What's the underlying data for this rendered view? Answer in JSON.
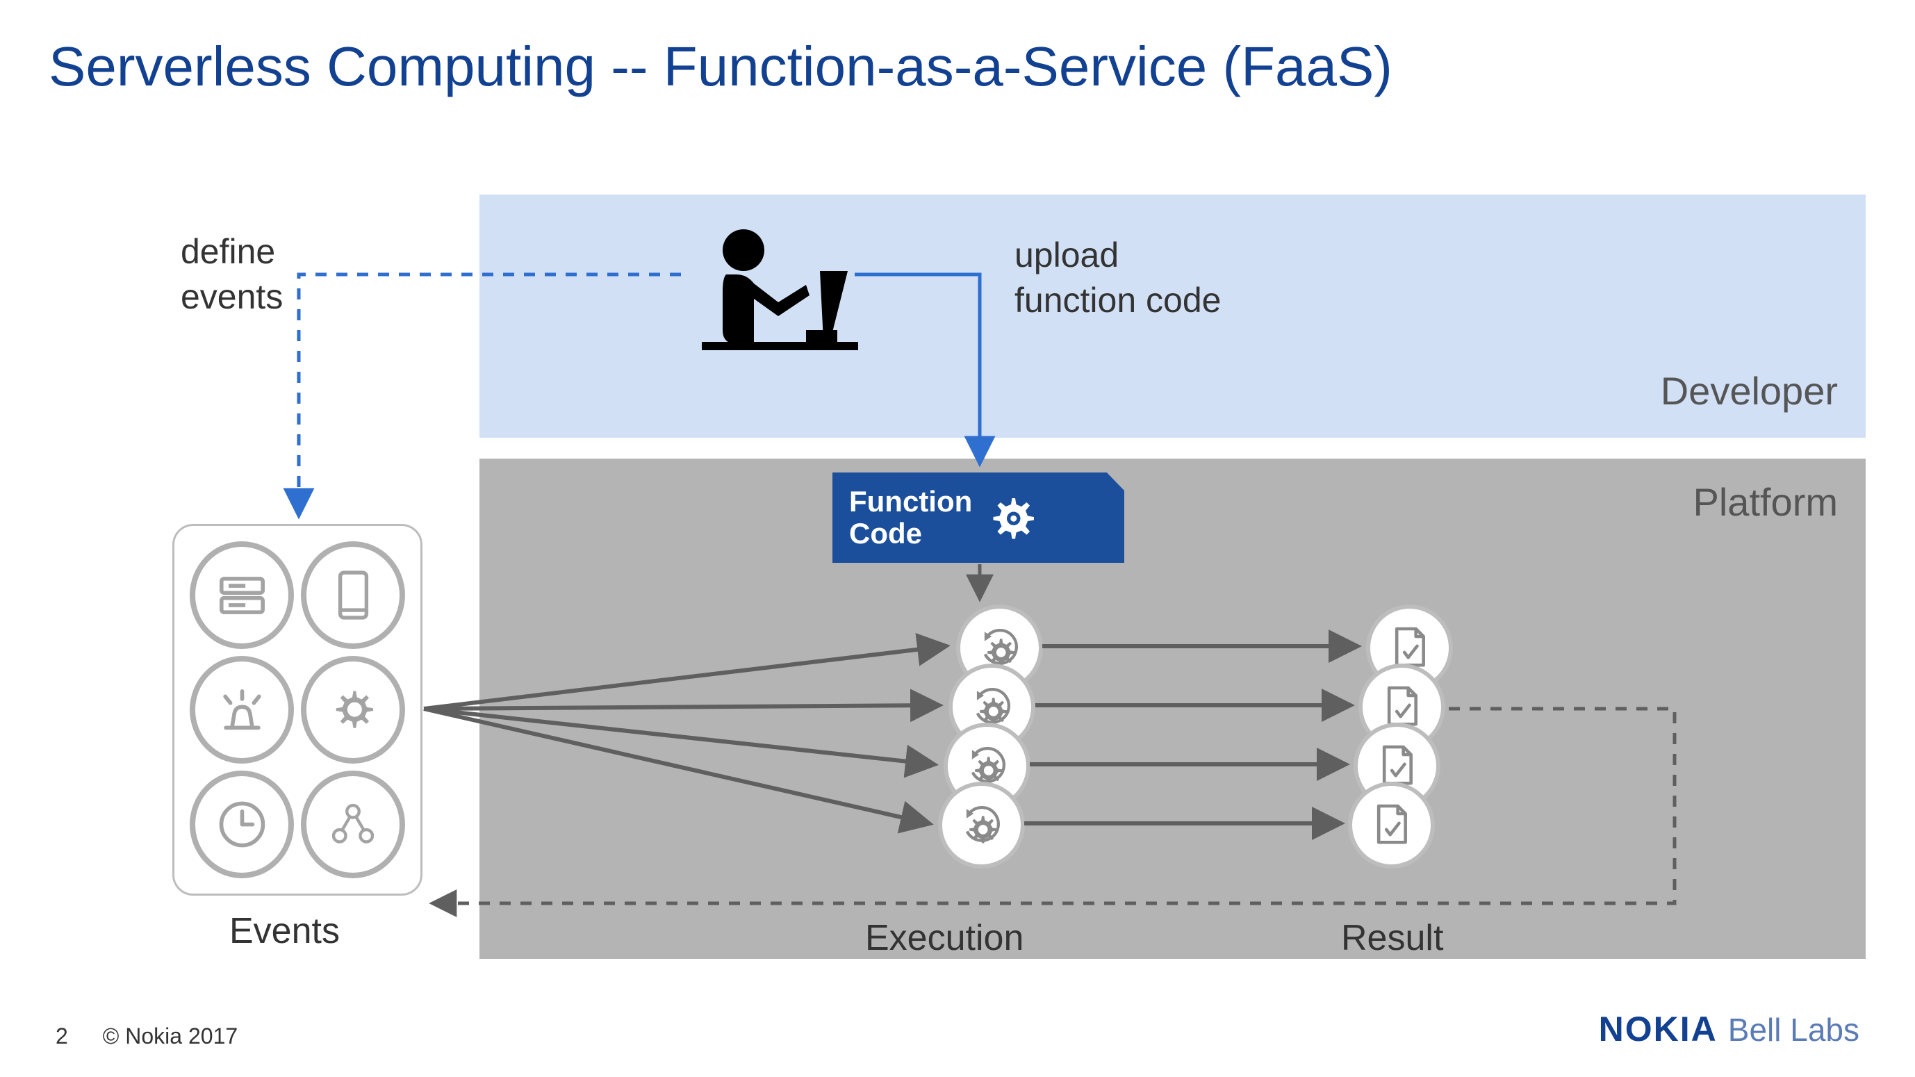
{
  "title": "Serverless Computing -- Function-as-a-Service (FaaS)",
  "labels": {
    "define_events_1": "define",
    "define_events_2": "events",
    "upload_1": "upload",
    "upload_2": "function code",
    "developer": "Developer",
    "platform": "Platform",
    "function_code_1": "Function",
    "function_code_2": "Code",
    "events": "Events",
    "execution": "Execution",
    "result": "Result"
  },
  "footer": {
    "page": "2",
    "copyright": "© Nokia 2017"
  },
  "logo": {
    "brand": "NOKIA",
    "sub": "Bell Labs"
  },
  "colors": {
    "title": "#124191",
    "developer_bg": "#d2e0f6",
    "platform_bg": "#b4b4b4",
    "function_code_bg": "#1b4f9c",
    "icon_gray": "#a3a3a3",
    "arrow_blue": "#2f6fcf",
    "arrow_gray": "#5f5f5f"
  }
}
